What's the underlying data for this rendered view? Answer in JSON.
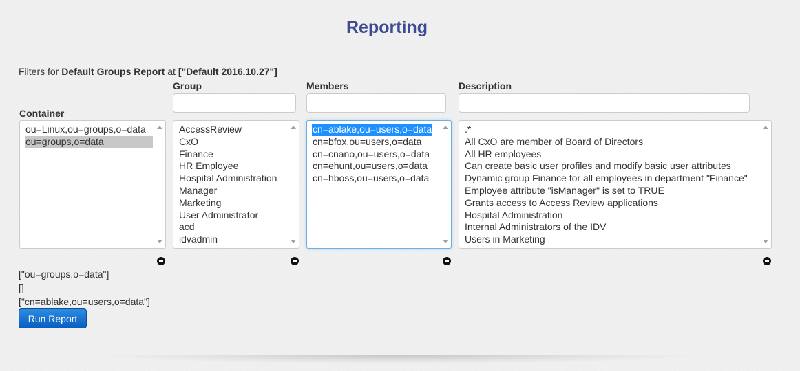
{
  "page": {
    "title": "Reporting"
  },
  "filters": {
    "prefix": "Filters for ",
    "report_name": "Default Groups Report",
    "middle": " at ",
    "report_version": "[\"Default 2016.10.27\"]"
  },
  "columns": {
    "container": {
      "label": "Container",
      "items": [
        "ou=Linux,ou=groups,o=data",
        "ou=groups,o=data"
      ],
      "selected_index": 1
    },
    "group": {
      "label": "Group",
      "input_value": "",
      "items": [
        "AccessReview",
        "CxO",
        "Finance",
        "HR Employee",
        "Hospital Administration",
        "Manager",
        "Marketing",
        "User Administrator",
        "acd",
        "idvadmin"
      ],
      "selected_index": -1
    },
    "members": {
      "label": "Members",
      "input_value": "",
      "items": [
        "cn=ablake,ou=users,o=data",
        "cn=bfox,ou=users,o=data",
        "cn=cnano,ou=users,o=data",
        "cn=ehunt,ou=users,o=data",
        "cn=hboss,ou=users,o=data"
      ],
      "selected_index": 0
    },
    "description": {
      "label": "Description",
      "input_value": "",
      "items": [
        ".*",
        "All CxO are member of Board of Directors",
        "All HR employees",
        "Can create basic user profiles and modify basic user attributes",
        "Dynamic group Finance for all employees in department \"Finance\"",
        "Employee attribute \"isManager\" is set to TRUE",
        "Grants access to Access Review applications",
        "Hospital Administration",
        "Internal Administrators of the IDV",
        "Users in Marketing"
      ],
      "selected_index": -1
    }
  },
  "selections": [
    "[\"ou=groups,o=data\"]",
    "[]",
    "[\"cn=ablake,ou=users,o=data\"]"
  ],
  "actions": {
    "run_report": "Run Report"
  },
  "icons": {
    "remove": "minus-circle-icon",
    "scroll_up": "arrow-up-icon",
    "scroll_down": "arrow-down-icon"
  },
  "colors": {
    "title": "#3e4a91",
    "selection": "#1e90ff",
    "button": "#0a5fc0"
  }
}
